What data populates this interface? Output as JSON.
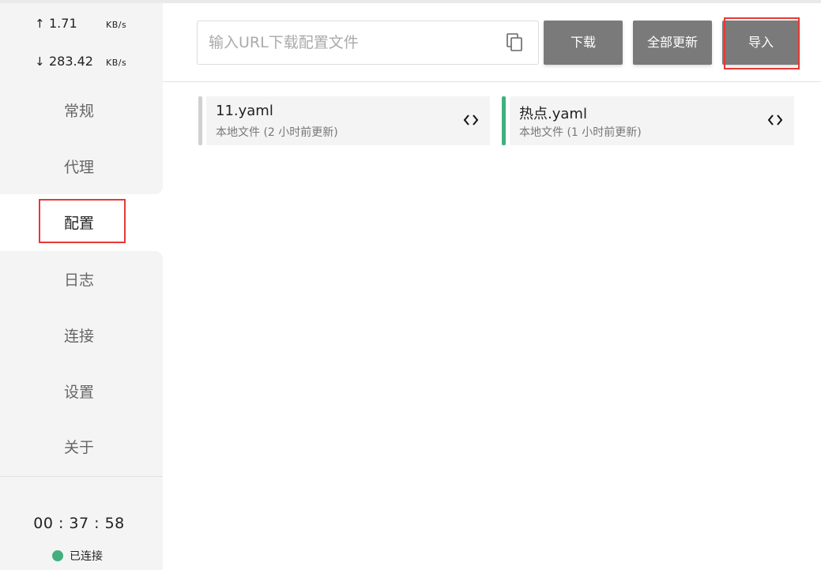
{
  "speed": {
    "up_arrow": "↑",
    "up_value": "1.71",
    "up_unit": "KB/s",
    "down_arrow": "↓",
    "down_value": "283.42",
    "down_unit": "KB/s"
  },
  "nav": {
    "items": [
      {
        "label": "常规"
      },
      {
        "label": "代理"
      },
      {
        "label": "配置"
      },
      {
        "label": "日志"
      },
      {
        "label": "连接"
      },
      {
        "label": "设置"
      },
      {
        "label": "关于"
      }
    ],
    "active_index": 2
  },
  "footer": {
    "timer": "00 : 37 : 58",
    "status": "已连接",
    "status_color": "#41b07e"
  },
  "toolbar": {
    "url_placeholder": "输入URL下载配置文件",
    "url_value": "",
    "download_label": "下载",
    "update_all_label": "全部更新",
    "import_label": "导入"
  },
  "profiles": [
    {
      "name": "11.yaml",
      "meta": "本地文件 (2 小时前更新)",
      "active": false
    },
    {
      "name": "热点.yaml",
      "meta": "本地文件 (1 小时前更新)",
      "active": true
    }
  ],
  "icons": {
    "copy": "copy-icon",
    "edit": "code-brackets-icon"
  },
  "colors": {
    "accent_green": "#41b07e",
    "button_gray": "#7a7a7a",
    "highlight_red": "#e53935",
    "sidebar_bg": "#f4f4f4"
  }
}
